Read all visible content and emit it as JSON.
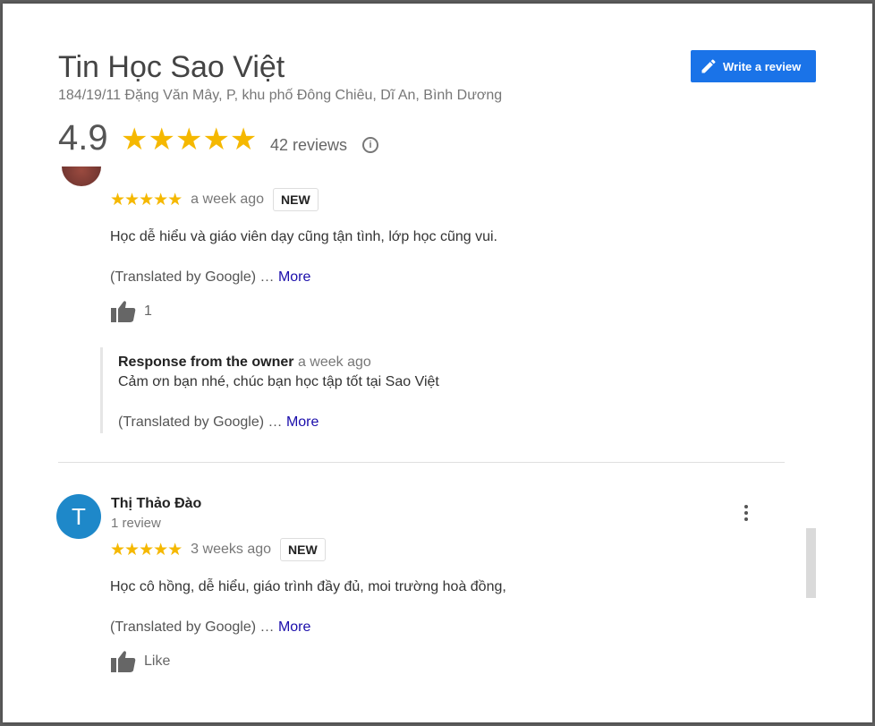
{
  "place": {
    "name": "Tin Học Sao Việt",
    "address": "184/19/11 Đặng Văn Mây, P, khu phố Đông Chiêu, Dĩ An, Bình Dương",
    "rating": "4.9",
    "stars": "★★★★★",
    "reviews_count": "42 reviews",
    "info_glyph": "i"
  },
  "actions": {
    "write_review": "Write a review"
  },
  "reviews": [
    {
      "stars": "★★★★★",
      "time": "a week ago",
      "badge": "NEW",
      "text": "Học dễ hiểu và giáo viên dạy cũng tận tình, lớp học cũng vui.",
      "translated": "(Translated by Google) …",
      "more": "More",
      "likes": "1",
      "owner_response": {
        "label": "Response from the owner",
        "time": "a week ago",
        "text": "Cảm ơn bạn nhé, chúc bạn học tập tốt tại Sao Việt",
        "translated": "(Translated by Google) …",
        "more": "More"
      }
    },
    {
      "avatar_letter": "T",
      "reviewer": "Thị Thảo Đào",
      "reviewer_reviews": "1 review",
      "stars": "★★★★★",
      "time": "3 weeks ago",
      "badge": "NEW",
      "text": "Học cô hồng, dễ hiểu, giáo trình đầy đủ, moi trường hoà đồng,",
      "translated": "(Translated by Google) …",
      "more": "More",
      "likes": "Like"
    }
  ],
  "colors": {
    "star": "#f5b800",
    "button": "#1a73e8",
    "avatar": "#1e88c9",
    "link": "#1a0dab"
  }
}
